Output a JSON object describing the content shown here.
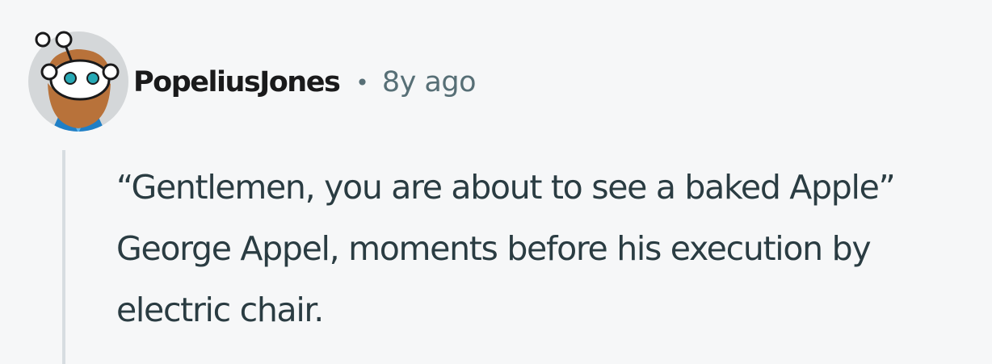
{
  "comment": {
    "author": "PopeliusJones",
    "separator": "•",
    "time": "8y ago",
    "body": "“Gentlemen, you are about to see a baked Apple” George Appel, moments before his execution by electric chair.",
    "avatar_icon": "snoo-avatar-icon"
  },
  "colors": {
    "background": "#f6f7f8",
    "username": "#1a1a1b",
    "meta": "#576f76",
    "body_text": "#2a3c42",
    "thread_line": "#d7dde1"
  }
}
